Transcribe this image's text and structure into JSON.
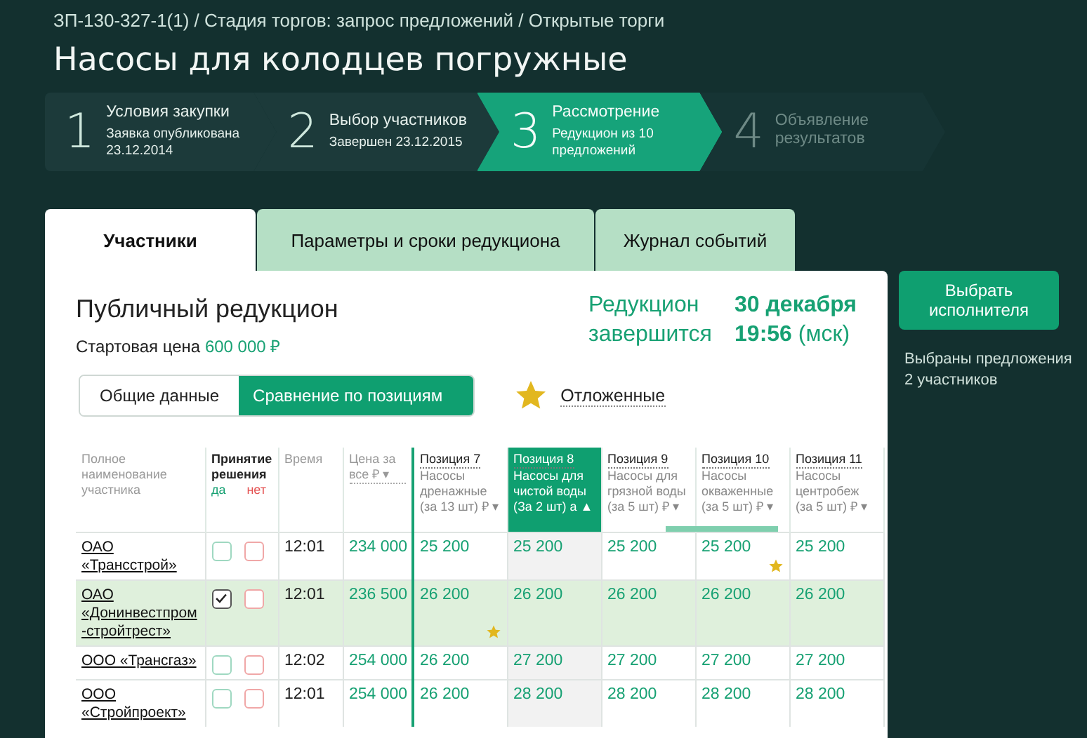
{
  "breadcrumb": "ЗП-130-327-1(1) / Стадия торгов: запрос предложений / Открытые торги",
  "title": "Насосы для колодцев погружные",
  "steps": [
    {
      "number": "1",
      "title": "Условия закупки",
      "subtitle": "Заявка опубликована 23.12.2014",
      "selected": false,
      "disabled": false
    },
    {
      "number": "2",
      "title": "Выбор участников",
      "subtitle": "Завершен 23.12.2015",
      "selected": false,
      "disabled": false
    },
    {
      "number": "3",
      "title": "Рассмотрение",
      "subtitle": "Редукцион из 10 предложений",
      "selected": true,
      "disabled": false
    },
    {
      "number": "4",
      "title": "Объявление результатов",
      "selected": false,
      "disabled": true
    }
  ],
  "tabs": [
    {
      "label": "Участники",
      "selected": true
    },
    {
      "label": "Параметры и сроки редукциона",
      "selected": false
    },
    {
      "label": "Журнал событий",
      "selected": false
    }
  ],
  "panel": {
    "heading": "Публичный редукцион",
    "start_price_label": "Стартовая цена",
    "start_price": "600 000 ₽",
    "deadline_label": "Редукцион завершится",
    "deadline_date": "30 декабря",
    "deadline_time": "19:56",
    "deadline_zone": "(мск)",
    "view_toggle": [
      {
        "label": "Общие данные",
        "selected": false
      },
      {
        "label": "Сравнение по позициям",
        "selected": true
      }
    ],
    "deferred_link": "Отложенные"
  },
  "table": {
    "columns": [
      {
        "kind": "name",
        "label": "Полное наименование участника"
      },
      {
        "kind": "decision",
        "label": "Принятие решения",
        "yes": "да",
        "no": "нет"
      },
      {
        "kind": "plain",
        "label": "Время"
      },
      {
        "kind": "price",
        "label": "Цена за все ₽ ▾"
      },
      {
        "kind": "position",
        "label": "Позиция 7",
        "detail": "Насосы дренажные (за 13 шт) ₽ ▾",
        "selected": false
      },
      {
        "kind": "position",
        "label": "Позиция 8",
        "detail": "Насосы для чистой воды (За 2 шт) а ▲",
        "selected": true
      },
      {
        "kind": "position",
        "label": "Позиция 9",
        "detail": "Насосы для грязной воды (за 5 шт) ₽ ▾",
        "selected": false
      },
      {
        "kind": "position",
        "label": "Позиция 10",
        "detail": "Насосы окваженные (за 5 шт) ₽ ▾",
        "selected": false
      },
      {
        "kind": "position",
        "label": "Позиция 11",
        "detail": "Насосы центробеж (за 5 шт) ₽ ▾",
        "selected": false
      }
    ],
    "rows": [
      {
        "selected": false,
        "cells": [
          {
            "kind": "name",
            "text": "ОАО «Трансстрой»"
          },
          {
            "kind": "decision",
            "yes": false,
            "no": false
          },
          {
            "kind": "time",
            "text": "12:01"
          },
          {
            "kind": "price",
            "text": "234 000"
          },
          {
            "kind": "price",
            "text": "25 200",
            "starred": false
          },
          {
            "kind": "price",
            "text": "25 200",
            "starred": false
          },
          {
            "kind": "price",
            "text": "25 200",
            "starred": false
          },
          {
            "kind": "price",
            "text": "25 200",
            "starred": true
          },
          {
            "kind": "price",
            "text": "25 200",
            "starred": false
          }
        ]
      },
      {
        "selected": true,
        "cells": [
          {
            "kind": "name",
            "text": "ОАО «Донинвестпром-стройтрест»"
          },
          {
            "kind": "decision",
            "yes": true,
            "no": false
          },
          {
            "kind": "time",
            "text": "12:01"
          },
          {
            "kind": "price",
            "text": "236 500"
          },
          {
            "kind": "price",
            "text": "26 200",
            "starred": true
          },
          {
            "kind": "price",
            "text": "26 200",
            "starred": false
          },
          {
            "kind": "price",
            "text": "26 200",
            "starred": false
          },
          {
            "kind": "price",
            "text": "26 200",
            "starred": false
          },
          {
            "kind": "price",
            "text": "26 200",
            "starred": false
          }
        ]
      },
      {
        "selected": false,
        "cells": [
          {
            "kind": "name",
            "text": "ООО «Трансгаз»"
          },
          {
            "kind": "decision",
            "yes": false,
            "no": false
          },
          {
            "kind": "time",
            "text": "12:02"
          },
          {
            "kind": "price",
            "text": "254 000"
          },
          {
            "kind": "price",
            "text": "26 200",
            "starred": false
          },
          {
            "kind": "price",
            "text": "27 200",
            "starred": false
          },
          {
            "kind": "price",
            "text": "27 200",
            "starred": false
          },
          {
            "kind": "price",
            "text": "27 200",
            "starred": false
          },
          {
            "kind": "price",
            "text": "27 200",
            "starred": false
          }
        ]
      },
      {
        "selected": false,
        "cells": [
          {
            "kind": "name",
            "text": "ООО «Стройпроект»"
          },
          {
            "kind": "decision",
            "yes": false,
            "no": false
          },
          {
            "kind": "time",
            "text": "12:01"
          },
          {
            "kind": "price",
            "text": "254 000"
          },
          {
            "kind": "price",
            "text": "26 200",
            "starred": false
          },
          {
            "kind": "price",
            "text": "28 200",
            "starred": false
          },
          {
            "kind": "price",
            "text": "28 200",
            "starred": false
          },
          {
            "kind": "price",
            "text": "28 200",
            "starred": false
          },
          {
            "kind": "price",
            "text": "28 200",
            "starred": false
          }
        ]
      }
    ]
  },
  "side": {
    "button": "Выбрать исполнителя",
    "note": "Выбраны предложения 2 участников"
  }
}
